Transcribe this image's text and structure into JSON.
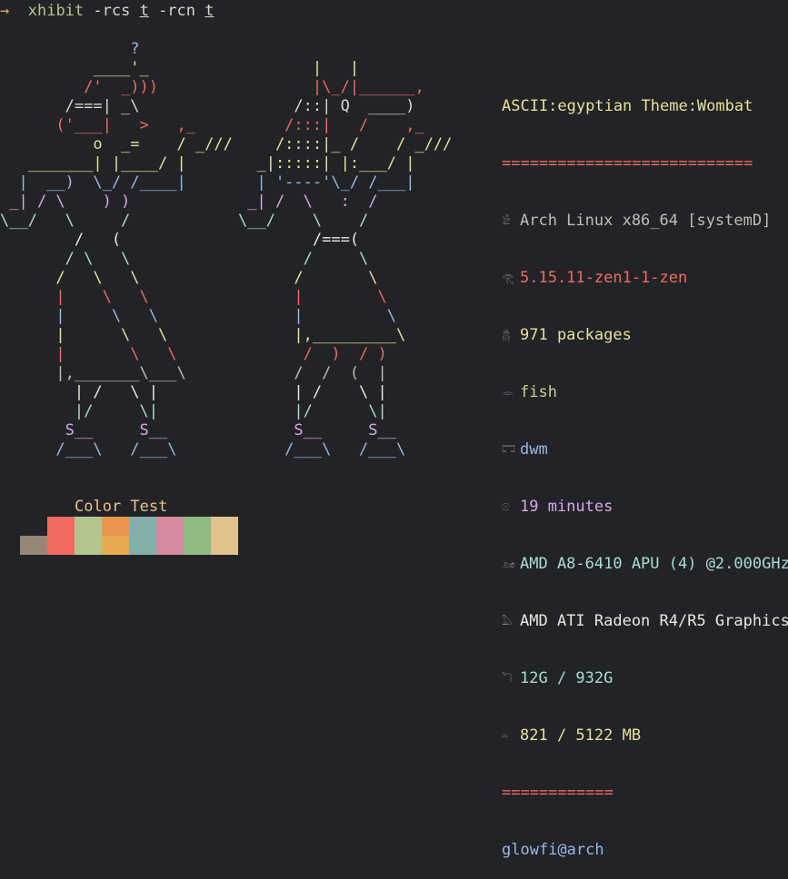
{
  "prompt": {
    "arrow": "→",
    "command": "xhibit",
    "args_pre": " -rcs ",
    "arg1": "t",
    "args_mid": " -rcn ",
    "arg2": "t"
  },
  "art": {
    "left": [
      {
        "t": "              ?",
        "c": "#9ab8e6"
      },
      {
        "t": "          ____'_",
        "c": "#e8e09a"
      },
      {
        "t": "         /'  _)))",
        "c": "#ef6b62"
      },
      {
        "t": "       /===| _\\",
        "c": "#d8d8d0"
      },
      {
        "t": "      ('___|   >   ,_",
        "c": "#ef6b62"
      },
      {
        "t": "          o  _=    / _///",
        "c": "#e8e09a"
      },
      {
        "t": "   _______| |____/ |",
        "c": "#e8e09a"
      },
      {
        "t": "  |  __)  \\_/ /____|",
        "c": "#9ab8e6"
      },
      {
        "t": " _| / \\    ) )",
        "c": "#d7a8e6"
      },
      {
        "t": "\\__/   \\     /",
        "c": "#a8dcd8"
      },
      {
        "t": "        /   (",
        "c": "#e8e8e0"
      },
      {
        "t": "       / \\   \\",
        "c": "#a8dcd8"
      },
      {
        "t": "      /   \\   \\",
        "c": "#e8e09a"
      },
      {
        "t": "      |    \\   \\",
        "c": "#ef6b62"
      },
      {
        "t": "      |     \\   \\",
        "c": "#9ab8e6"
      },
      {
        "t": "      |      \\   \\",
        "c": "#e8e09a"
      },
      {
        "t": "      |       \\   \\",
        "c": "#ef6b62"
      },
      {
        "t": "      |,_______\\___\\",
        "c": "#bdbdb5"
      },
      {
        "t": "        | /   \\ |",
        "c": "#e8e8e0"
      },
      {
        "t": "        |/     \\|",
        "c": "#a8dcd8"
      },
      {
        "t": "       S__     S__",
        "c": "#d7a8e6"
      },
      {
        "t": "      /___\\   /___\\",
        "c": "#9ab8e6"
      }
    ],
    "right": [
      {
        "t": "",
        "c": "#e8e8e0"
      },
      {
        "t": "        |   |",
        "c": "#e8e09a"
      },
      {
        "t": "        |\\_/|______,",
        "c": "#ef6b62"
      },
      {
        "t": "      /::| Q  ____)",
        "c": "#d8d8d0"
      },
      {
        "t": "     /:::|   /    ,_",
        "c": "#ef6b62"
      },
      {
        "t": "    /::::|_ /    / _///",
        "c": "#e8e09a"
      },
      {
        "t": "  _|:::::| |:___/ |",
        "c": "#e8e09a"
      },
      {
        "t": "  | '----'\\_/ /___|",
        "c": "#9ab8e6"
      },
      {
        "t": " _| /  \\   :  /",
        "c": "#d7a8e6"
      },
      {
        "t": "\\__/    \\    /",
        "c": "#a8dcd8"
      },
      {
        "t": "        /===(",
        "c": "#e8e8e0"
      },
      {
        "t": "       /     \\",
        "c": "#a8dcd8"
      },
      {
        "t": "      /       \\",
        "c": "#e8e09a"
      },
      {
        "t": "      |        \\",
        "c": "#ef6b62"
      },
      {
        "t": "      |         \\",
        "c": "#9ab8e6"
      },
      {
        "t": "      |,_________\\",
        "c": "#e8e09a"
      },
      {
        "t": "       /  )  / )",
        "c": "#ef6b62"
      },
      {
        "t": "      /  /  (  |",
        "c": "#bdbdb5"
      },
      {
        "t": "      | /    \\ |",
        "c": "#e8e8e0"
      },
      {
        "t": "      |/      \\|",
        "c": "#a8dcd8"
      },
      {
        "t": "      S__     S__",
        "c": "#d7a8e6"
      },
      {
        "t": "     /___\\   /___\\",
        "c": "#9ab8e6"
      }
    ]
  },
  "info": {
    "header": "ASCII:egyptian Theme:Wombat",
    "sep_long": "===========================",
    "os": "Arch Linux x86_64 [systemD]",
    "kernel": "5.15.11-zen1-1-zen",
    "packages": "971 packages",
    "shell": "fish",
    "wm": "dwm",
    "uptime": "19 minutes",
    "cpu": "AMD A8-6410 APU (4) @2.000GHz",
    "gpu": "AMD ATI Radeon R4/R5 Graphics",
    "disk": "12G / 932G",
    "memory": "821 / 5122 MB",
    "sep_short": "============",
    "user_host": "glowfi@arch",
    "icons": [
      "os-icon",
      "kernel-icon",
      "packages-icon",
      "shell-icon",
      "wm-icon",
      "uptime-icon",
      "cpu-icon",
      "gpu-icon",
      "disk-icon",
      "memory-icon"
    ]
  },
  "color_test": {
    "label": "Color Test",
    "top_row": [
      "#ef6b62",
      "#b3c58c",
      "#e8944f",
      "#84b0ac",
      "#d68aa0",
      "#8fba82",
      "#e0c28e"
    ],
    "bottom_row": [
      "#968779",
      "#ef6b62",
      "#b3c58c",
      "#e8aa4f",
      "#84b0ac",
      "#d68aa0",
      "#8fba82",
      "#e0c28e"
    ]
  }
}
